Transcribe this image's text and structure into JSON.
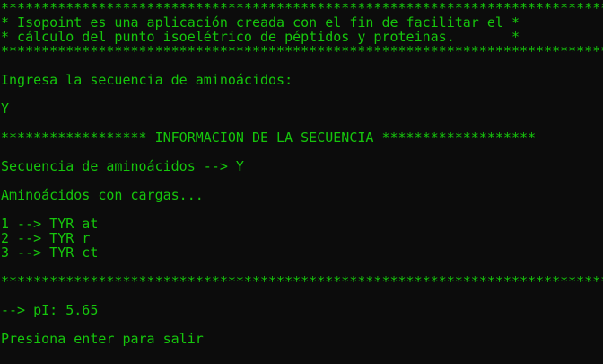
{
  "terminal": {
    "text_color": "#16c60c",
    "background_color": "#0c0c0c",
    "lines": [
      "****************************************************************************",
      "* Isopoint es una aplicación creada con el fin de facilitar el *",
      "* cálculo del punto isoelétrico de péptidos y proteinas.       *",
      "****************************************************************************",
      "",
      "Ingresa la secuencia de aminoácidos:",
      "",
      "Y",
      "",
      "****************** INFORMACION DE LA SECUENCIA *******************",
      "",
      "Secuencia de aminoácidos --> Y",
      "",
      "Aminoácidos con cargas...",
      "",
      "1 --> TYR_at",
      "2 --> TYR_r",
      "3 --> TYR_ct",
      "",
      "****************************************************************************",
      "",
      "--> pI: 5.65",
      "",
      "Presiona enter para salir"
    ]
  }
}
